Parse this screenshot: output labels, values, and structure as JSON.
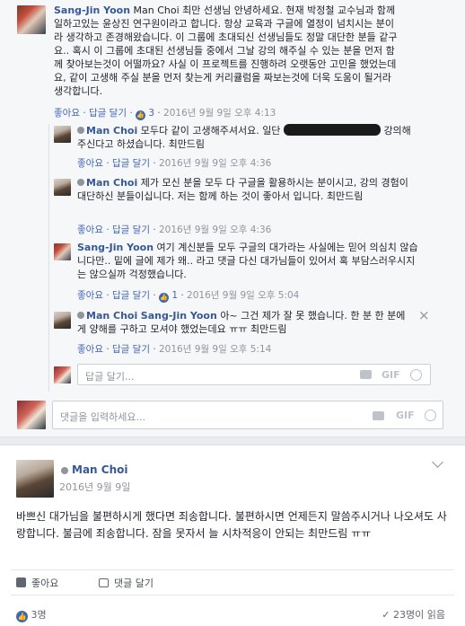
{
  "comment1": {
    "author": "Sang-Jin Yoon",
    "text": "Man Choi 최만 선생님 안녕하세요. 현재 박정철 교수님과 함께 일하고있는 윤상진 연구원이라고 합니다. 항상 교육과 구글에 열정이 넘치시는 분이라 생각하고 존경해왔습니다. 이 그룹에 초대되신 선생님들도 정말 대단한 분들 같구요.. 혹시 이 그룹에 초대된 선생님들 중에서 그날 강의 해주실 수 있는 분을 먼저 함께 찾아보는것이 어떨까요? 사실 이 프로젝트를 진행하려 오랫동안 고민을 했었는데요, 같이 고생해 주실 분을 먼저 찾는게 커리큘럼을 짜보는것에 더욱 도움이 될거라 생각합니다.",
    "like": "좋아요",
    "reply": "답글 달기",
    "reactions": "3",
    "time": "2016년 9월 9일 오후 4:13"
  },
  "reply1": {
    "author": "Man Choi",
    "text_a": "모두다 같이 고생해주셔서요. 일단",
    "text_b": "강의해주신다고 하셨습니다. 최만드림",
    "like": "좋아요",
    "reply": "답글 달기",
    "time": "2016년 9월 9일 오후 4:36"
  },
  "reply2": {
    "author": "Man Choi",
    "text": "제가 모신 분을 모두 다 구글을 활용하시는 분이시고, 강의 경험이 대단하신 분들이십니다. 저는 함께 하는 것이 좋아서 입니다. 최만드림",
    "like": "좋아요",
    "reply": "답글 달기",
    "time": "2016년 9월 9일 오후 4:36"
  },
  "reply3": {
    "author": "Sang-Jin Yoon",
    "text": "여기 계신분들 모두 구글의 대가라는 사실에는 믿어 의심치 않습니다만.. 밑에 글에 제가 왜.. 라고 댓글 다신 대가님들이 있어서 혹 부담스러우시지는 않으실까 걱정했습니다.",
    "like": "좋아요",
    "reply": "답글 달기",
    "reactions": "1",
    "time": "2016년 9월 9일 오후 5:04"
  },
  "reply4": {
    "author": "Man Choi",
    "mention": "Sang-Jin Yoon",
    "text": "아~ 그건 제가 잘 못 했습니다. 한 분 한 분에게 양해를 구하고 모셔야 했었는데요 ㅠㅠ 최만드림",
    "like": "좋아요",
    "reply": "답글 달기",
    "time": "2016년 9월 9일 오후 5:14",
    "close": "×"
  },
  "reply_input": {
    "placeholder": "답글 달기...",
    "gif": "GIF"
  },
  "comment_input": {
    "placeholder": "댓글을 입력하세요...",
    "gif": "GIF"
  },
  "post": {
    "author": "Man Choi",
    "date": "2016년 9월 9일",
    "body": "바쁘신 대가님을 불편하시게 했다면 죄송합니다. 불편하시면 언제든지 말씀주시거나 나오셔도 사랑합니다. 불금에 죄송합니다. 잠을 못자서 늘 시차적응이 안되는 최만드림 ㅠㅠ",
    "like": "좋아요",
    "comment": "댓글 달기",
    "reactions_count": "3명",
    "seen": "23명이 읽음"
  },
  "colors": {
    "link": "#365899",
    "accent": "#4267b2",
    "muted": "#90949c"
  }
}
